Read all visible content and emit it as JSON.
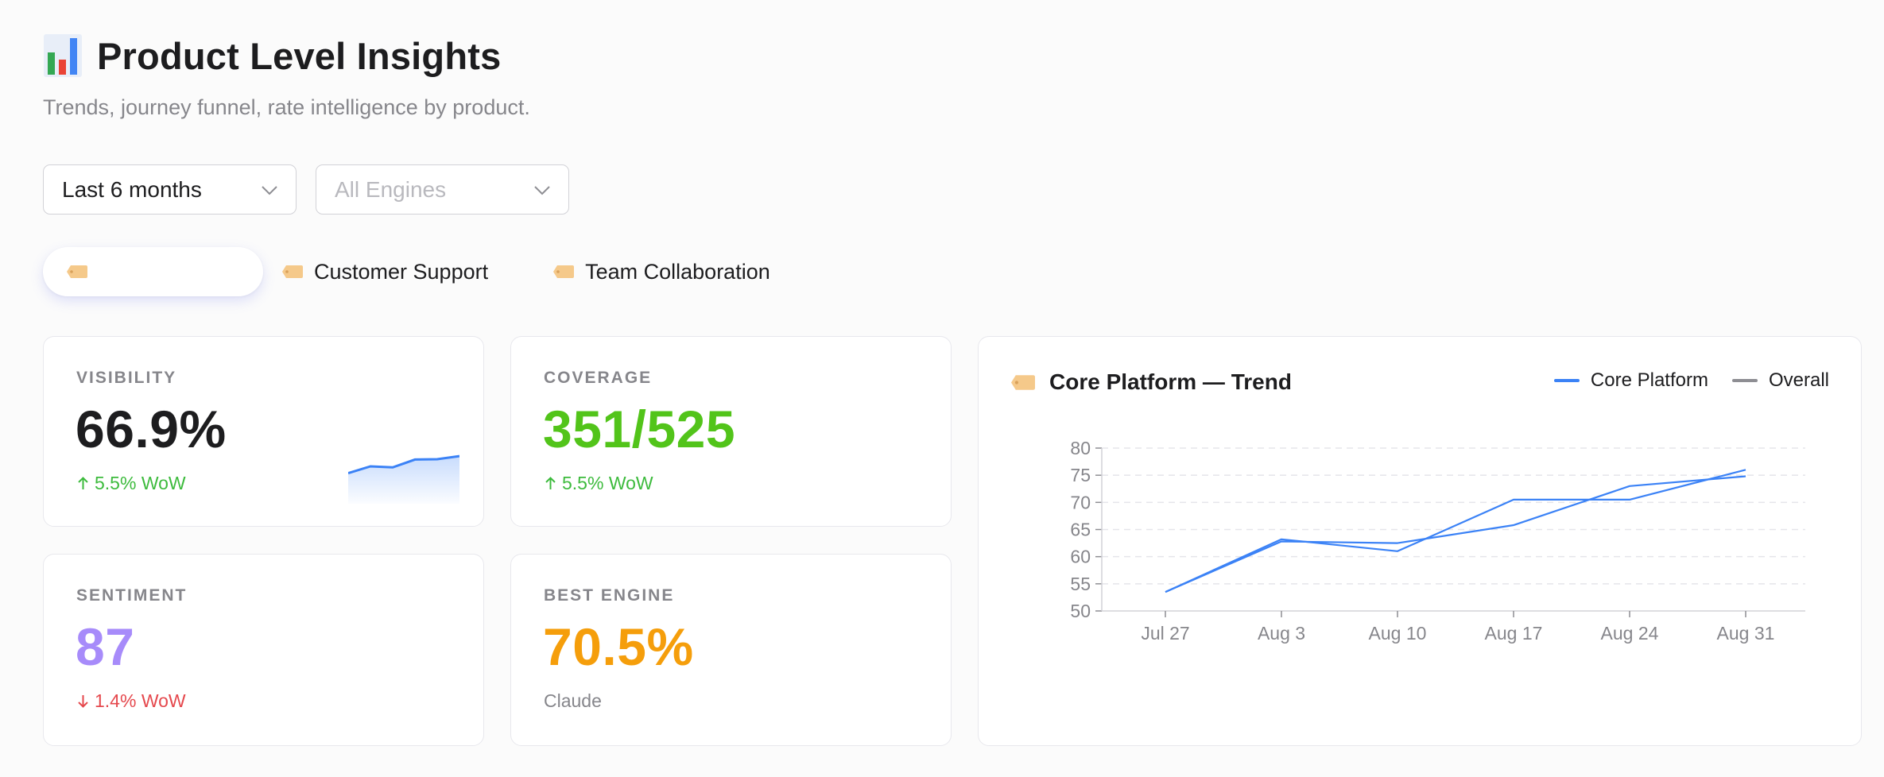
{
  "page": {
    "title": "Product Level Insights",
    "subtitle": "Trends, journey funnel, rate intelligence by product.",
    "title_icon": "bar-chart-icon"
  },
  "filters": {
    "time_range": {
      "value": "Last 6 months",
      "icon": "chevron-down-icon"
    },
    "engine": {
      "placeholder": "All Engines",
      "icon": "chevron-down-icon"
    }
  },
  "product_tabs": [
    {
      "label": "",
      "active": true,
      "icon": "tag-icon"
    },
    {
      "label": "Customer Support",
      "active": false,
      "icon": "tag-icon"
    },
    {
      "label": "Team Collaboration",
      "active": false,
      "icon": "tag-icon"
    }
  ],
  "metrics": {
    "visibility": {
      "label": "VISIBILITY",
      "value": "66.9%",
      "change": "5.5% WoW",
      "direction": "up",
      "sparkline": [
        63.5,
        65.5,
        65.2,
        67.5,
        67.6,
        68.5
      ]
    },
    "coverage": {
      "label": "COVERAGE",
      "value": "351/525",
      "change": "5.5% WoW",
      "direction": "up"
    },
    "sentiment": {
      "label": "SENTIMENT",
      "value": "87",
      "change": "1.4% WoW",
      "direction": "down"
    },
    "best_engine": {
      "label": "BEST ENGINE",
      "value": "70.5%",
      "engine_name": "Claude"
    }
  },
  "colors": {
    "accent_blue": "#3b82f6",
    "up_green": "#3dbb3d",
    "down_red": "#e5484d",
    "coverage_green": "#52c41a",
    "sentiment_purple": "#a78bfa",
    "best_engine_orange": "#f59e0b",
    "tag_orange": "#f5c98a",
    "overall_gray": "#8e8e93"
  },
  "trend": {
    "title": "Core Platform — Trend",
    "icon": "tag-icon",
    "legend": [
      {
        "name": "Core Platform",
        "color": "#3b82f6"
      },
      {
        "name": "Overall",
        "color": "#8e8e93"
      }
    ]
  },
  "chart_data": {
    "type": "line",
    "title": "Core Platform — Trend",
    "xlabel": "",
    "ylabel": "",
    "x": [
      "Jul 27",
      "Aug 3",
      "Aug 10",
      "Aug 17",
      "Aug 24",
      "Aug 31"
    ],
    "ylim": [
      50,
      80
    ],
    "yticks": [
      80,
      75,
      70,
      65,
      60,
      55,
      50
    ],
    "grid": true,
    "legend_position": "top-right",
    "series": [
      {
        "name": "Core Platform",
        "values": [
          53.5,
          63.2,
          61.0,
          70.5,
          70.5,
          76.0
        ]
      },
      {
        "name": "Overall",
        "values": [
          53.5,
          62.8,
          62.5,
          65.8,
          73.0,
          74.8
        ]
      }
    ]
  }
}
